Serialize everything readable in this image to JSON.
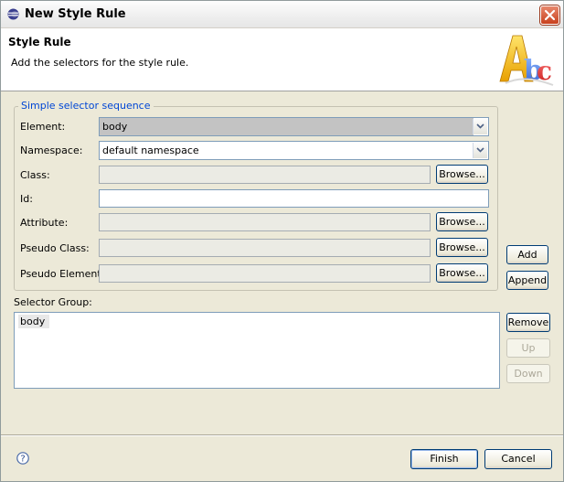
{
  "window": {
    "title": "New Style Rule",
    "header_title": "Style Rule",
    "header_description": "Add the selectors for the style rule."
  },
  "group": {
    "legend": "Simple selector sequence",
    "element_label": "Element:",
    "element_value": "body",
    "namespace_label": "Namespace:",
    "namespace_value": "default namespace",
    "class_label": "Class:",
    "class_value": "",
    "id_label": "Id:",
    "id_value": "",
    "attribute_label": "Attribute:",
    "attribute_value": "",
    "pseudo_class_label": "Pseudo Class:",
    "pseudo_class_value": "",
    "pseudo_element_label": "Pseudo Element:",
    "pseudo_element_value": "",
    "browse_label": "Browse..."
  },
  "side_buttons": {
    "add": "Add",
    "append": "Append",
    "remove": "Remove",
    "up": "Up",
    "down": "Down"
  },
  "selector_group": {
    "label": "Selector Group:",
    "items": [
      "body"
    ]
  },
  "footer": {
    "finish": "Finish",
    "cancel": "Cancel"
  },
  "colors": {
    "legend": "#0046d5",
    "close_button": "#c8411e",
    "dialog_background": "#ece9d8"
  }
}
